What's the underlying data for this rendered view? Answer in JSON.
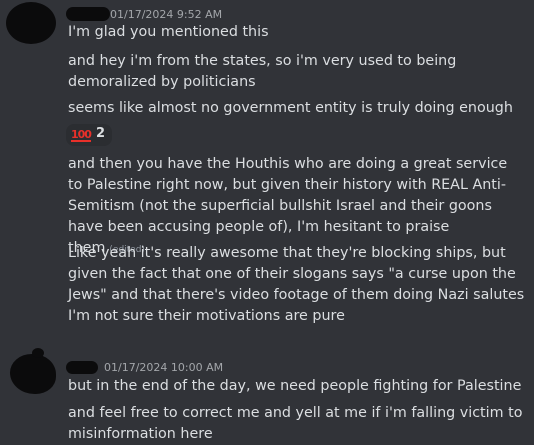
{
  "group1": {
    "timestamp": "01/17/2024 9:52 AM",
    "messages": [
      "I'm glad you mentioned this",
      "and hey i'm from the states, so i'm very used to being demoralized by politicians",
      "seems like almost no government entity is truly doing enough"
    ],
    "reaction": {
      "emoji": "💯",
      "emoji_text": "100",
      "icon": "hundred-points-icon",
      "count": "2"
    },
    "messages_after": [
      "and then you have the Houthis who are doing a great service to Palestine right now, but given their history with REAL Anti-Semitism (not the superficial bullshit Israel and their goons have been accusing people of), I'm hesitant to praise them",
      "Like yeah it's really awesome that they're blocking ships, but given the fact that one of their slogans says \"a curse upon the Jews\" and that there's video footage of them doing Nazi salutes I'm not sure their motivations are pure"
    ],
    "edited_label": "(edited)"
  },
  "group2": {
    "timestamp": "01/17/2024 10:00 AM",
    "messages": [
      "but in the end of the day, we need people fighting for Palestine",
      "and feel free to correct me and yell at me if i'm falling victim to misinformation here"
    ]
  },
  "colors": {
    "background": "#313338",
    "text": "#dbdee1",
    "timestamp": "#a3a6aa",
    "reaction_bg": "#2b2d31",
    "reaction_emoji": "#e8302a"
  }
}
